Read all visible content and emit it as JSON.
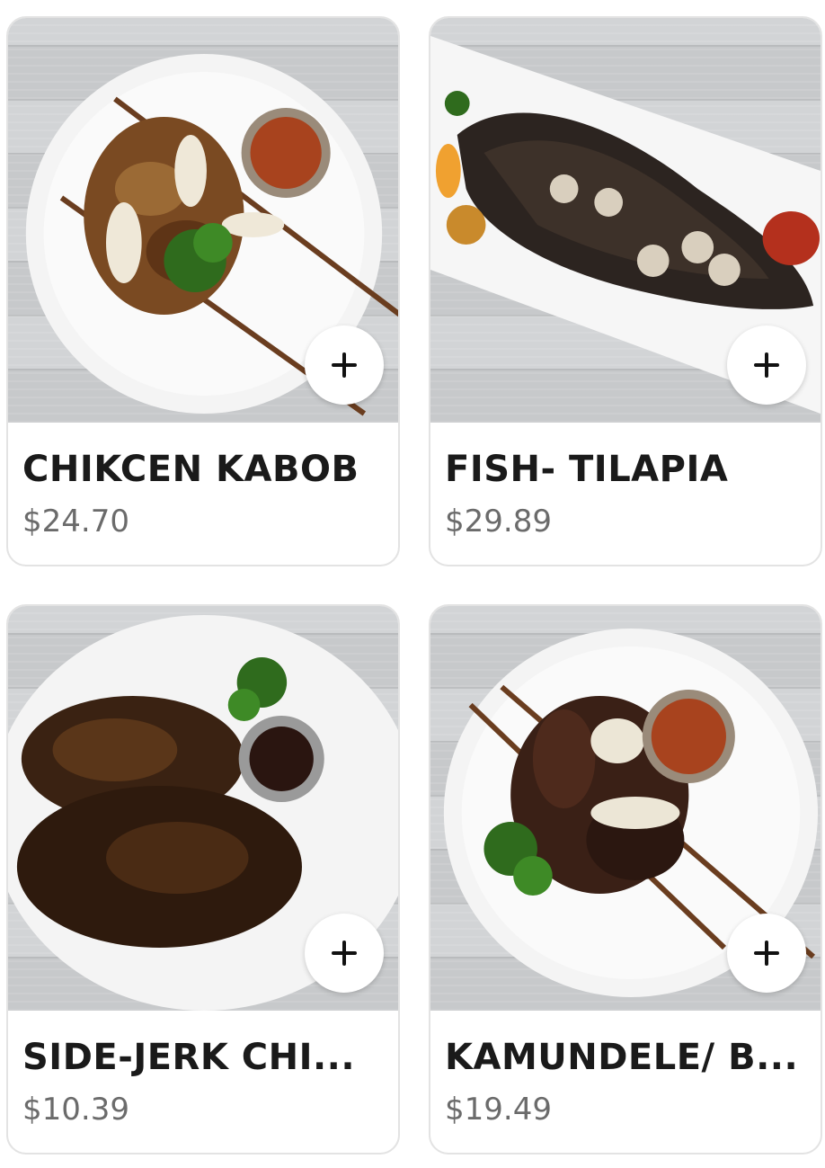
{
  "menu_items": [
    {
      "name": "CHIKCEN KABOB",
      "price": "$24.70",
      "image_icon": "chicken-kabob-plate"
    },
    {
      "name": "FISH- TILAPIA",
      "price": "$29.89",
      "image_icon": "fried-tilapia-plate"
    },
    {
      "name": "SIDE-JERK CHI...",
      "price": "$10.39",
      "image_icon": "jerk-chicken-plate"
    },
    {
      "name": "KAMUNDELE/ B...",
      "price": "$19.49",
      "image_icon": "beef-skewers-plate"
    }
  ],
  "colors": {
    "title": "#1a1a1a",
    "price": "#6b6b6b",
    "card_border": "#e3e3e3",
    "button_bg": "#ffffff"
  }
}
